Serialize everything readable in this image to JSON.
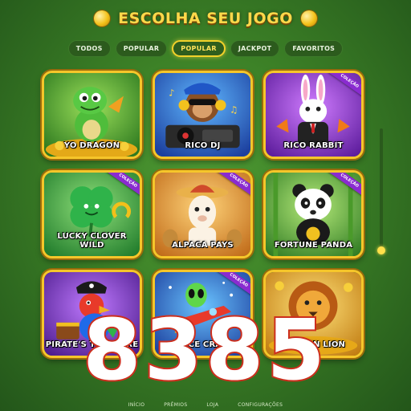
{
  "header": {
    "title": "ESCOLHA SEU JOGO"
  },
  "tabs": [
    {
      "label": "TODOS"
    },
    {
      "label": "POPULAR"
    },
    {
      "label": "POPULAR"
    },
    {
      "label": "JACKPOT"
    },
    {
      "label": "FAVORITOS"
    }
  ],
  "active_tab_index": 2,
  "games": [
    {
      "name": "YO DRAGON",
      "badge": ""
    },
    {
      "name": "RICO DJ",
      "badge": ""
    },
    {
      "name": "RICO RABBIT",
      "badge": "COLEÇÃO"
    },
    {
      "name": "LUCKY CLOVER WILD",
      "badge": "COLEÇÃO"
    },
    {
      "name": "ALPACA PAYS",
      "badge": "COLEÇÃO"
    },
    {
      "name": "FORTUNE PANDA",
      "badge": "COLEÇÃO"
    },
    {
      "name": "PIRATE'S TREASURE",
      "badge": ""
    },
    {
      "name": "SPACE CRASH",
      "badge": "COLEÇÃO"
    },
    {
      "name": "GOLDEN LION",
      "badge": ""
    }
  ],
  "bottom_nav": [
    {
      "label": "INÍCIO"
    },
    {
      "label": "PRÊMIOS"
    },
    {
      "label": "LOJA"
    },
    {
      "label": "CONFIGURAÇÕES"
    }
  ],
  "overlay_number": "8385",
  "colors": {
    "background": "#3b7f26",
    "card_border": "#f6c62a",
    "active_tab": "#f2d12a",
    "badge": "#8a2bd0",
    "overlay_stroke": "#d2301f"
  }
}
